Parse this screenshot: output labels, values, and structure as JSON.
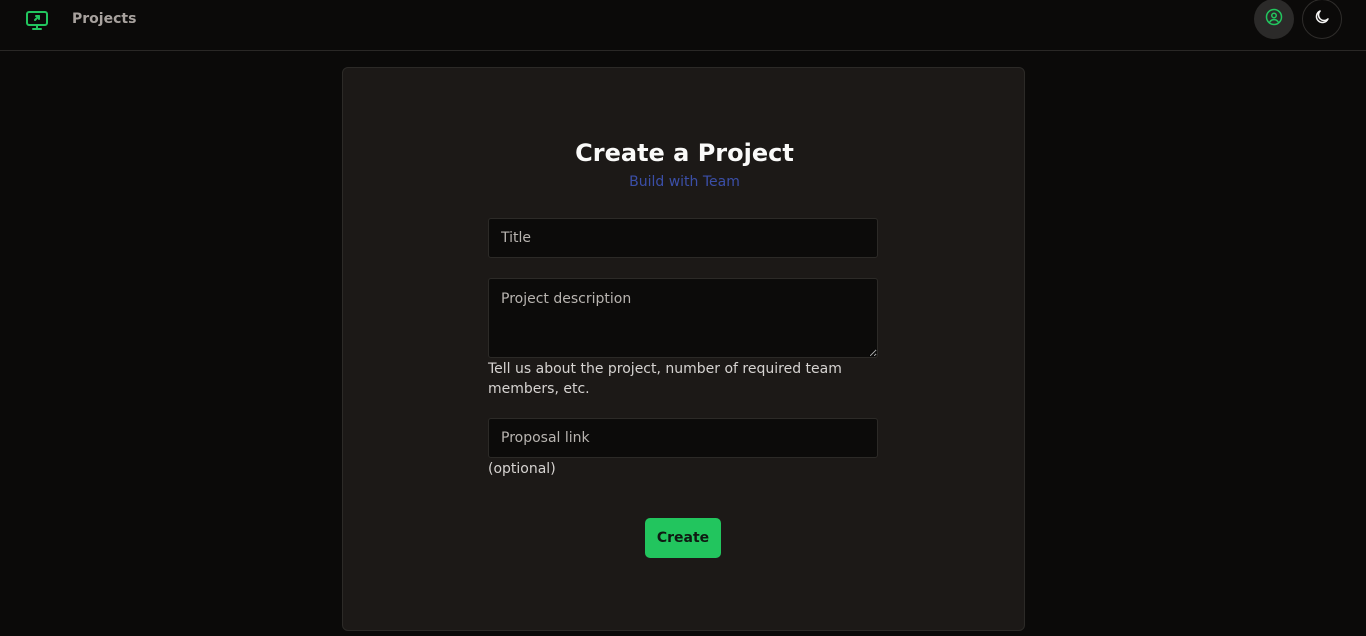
{
  "nav": {
    "logo_icon": "monitor-share-icon",
    "projects_label": "Projects",
    "profile_icon": "user-circle-icon",
    "theme_icon": "moon-icon"
  },
  "form": {
    "title": "Create a Project",
    "subtitle": "Build with Team",
    "title_field": {
      "placeholder": "Title",
      "value": ""
    },
    "description_field": {
      "placeholder": "Project description",
      "value": ""
    },
    "description_help": "Tell us about the project, number of required team members, etc.",
    "proposal_field": {
      "placeholder": "Proposal link",
      "value": ""
    },
    "proposal_help": "(optional)",
    "create_label": "Create"
  },
  "colors": {
    "accent": "#22c55e",
    "subtitle": "#3b4fa8",
    "background": "#0b0a09",
    "card": "#1c1917"
  }
}
